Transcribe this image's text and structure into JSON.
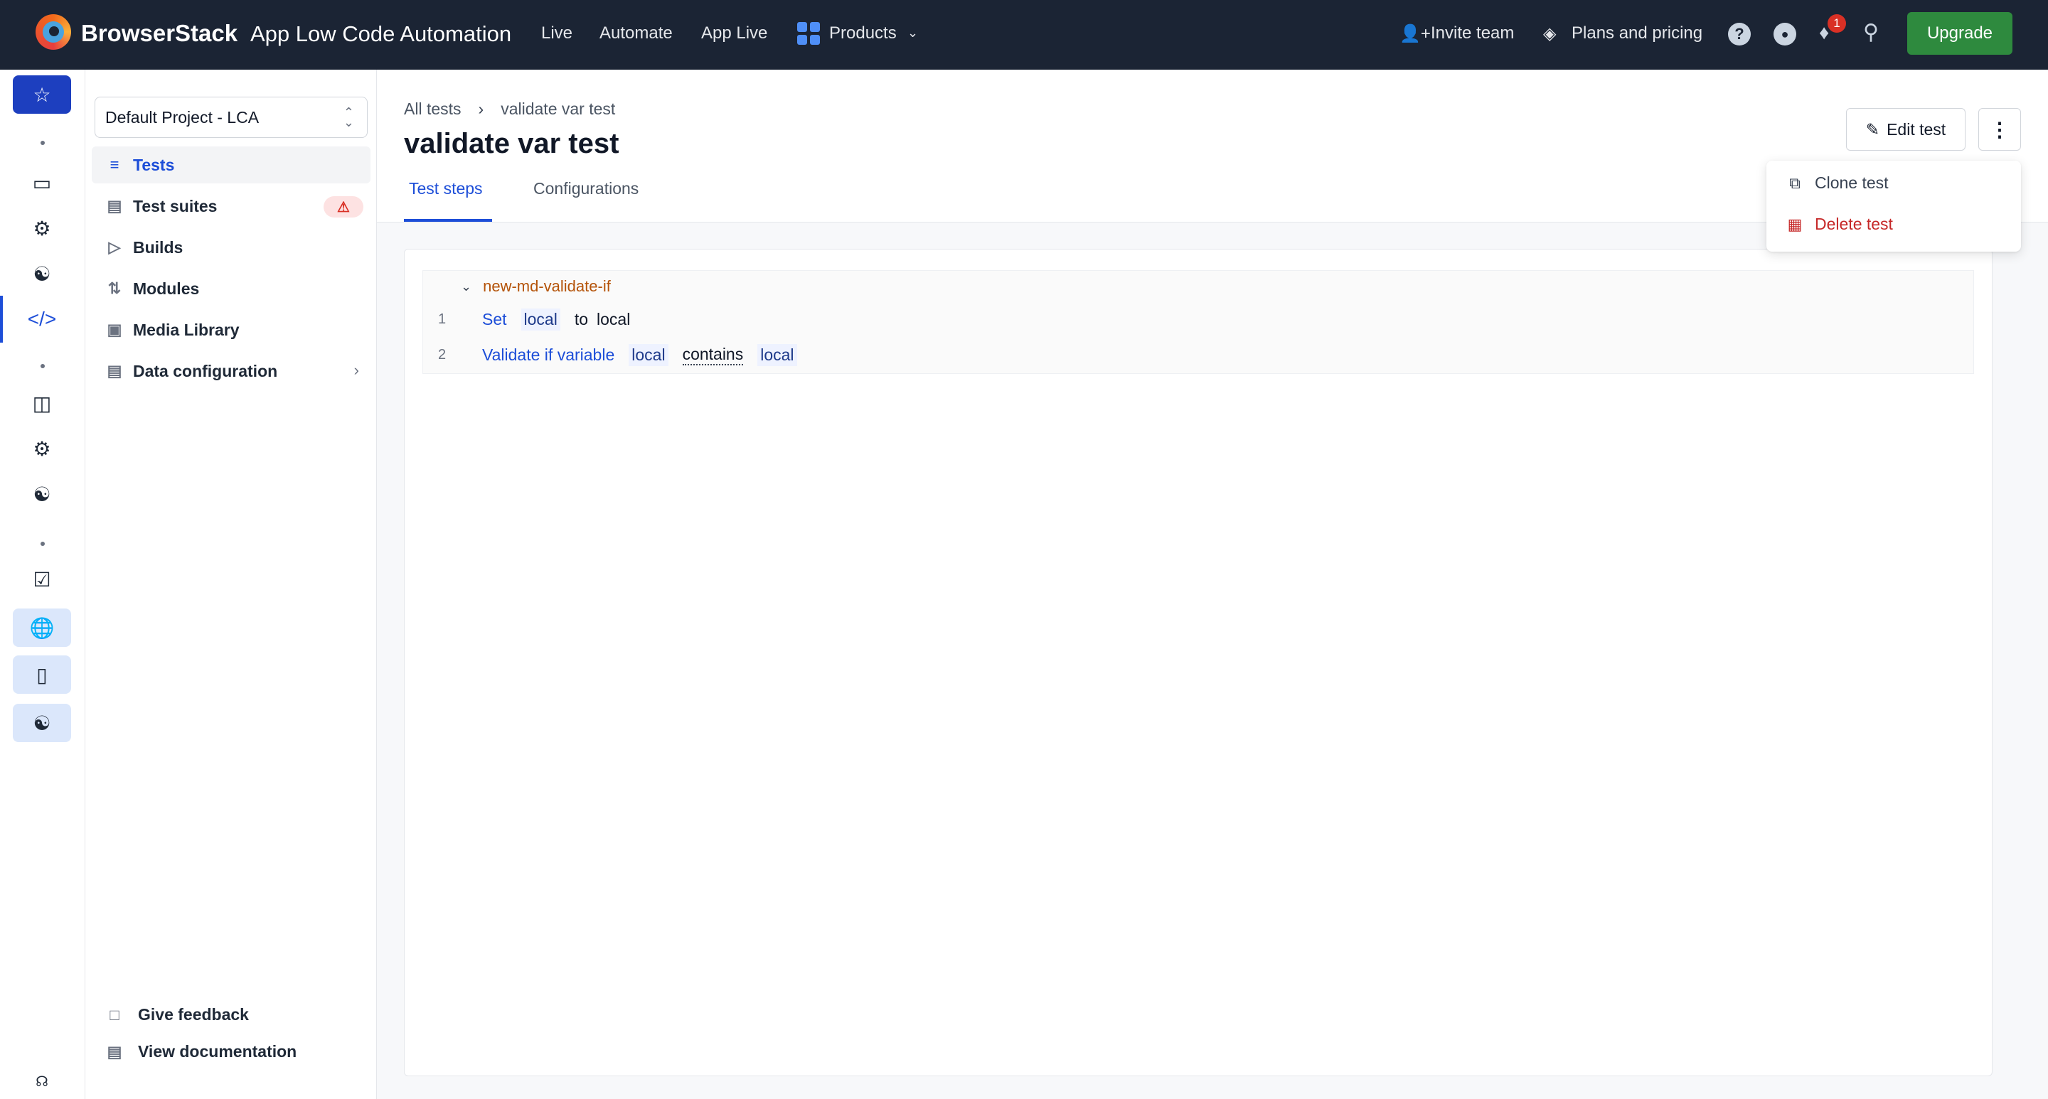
{
  "header": {
    "brand": "BrowserStack",
    "product": "App Low Code Automation",
    "nav": [
      "Live",
      "Automate",
      "App Live"
    ],
    "products_label": "Products",
    "invite_label": "Invite team",
    "pricing_label": "Plans and pricing",
    "notification_count": "1",
    "upgrade_label": "Upgrade"
  },
  "sidebar": {
    "project": "Default Project - LCA",
    "items": [
      {
        "label": "Tests",
        "icon": "list-icon"
      },
      {
        "label": "Test suites",
        "icon": "suite-icon"
      },
      {
        "label": "Builds",
        "icon": "play-icon"
      },
      {
        "label": "Modules",
        "icon": "modules-icon"
      },
      {
        "label": "Media Library",
        "icon": "image-icon"
      },
      {
        "label": "Data configuration",
        "icon": "data-icon"
      }
    ],
    "feedback": "Give feedback",
    "docs": "View documentation"
  },
  "main": {
    "breadcrumb": [
      "All tests",
      "validate var test"
    ],
    "title": "validate var test",
    "edit_label": "Edit test",
    "tabs": [
      "Test steps",
      "Configurations"
    ],
    "group": "new-md-validate-if",
    "steps": [
      {
        "num": "1",
        "action": "Set",
        "var": "local",
        "connector": "to",
        "value": "local"
      },
      {
        "num": "2",
        "action": "Validate if variable",
        "var": "local",
        "operator": "contains",
        "value": "local"
      }
    ]
  },
  "menu": {
    "clone": "Clone test",
    "delete": "Delete test"
  },
  "colors": {
    "header_bg": "#1b2434",
    "accent": "#1d4ed8",
    "upgrade": "#2e8a3e",
    "danger": "#c62828"
  }
}
